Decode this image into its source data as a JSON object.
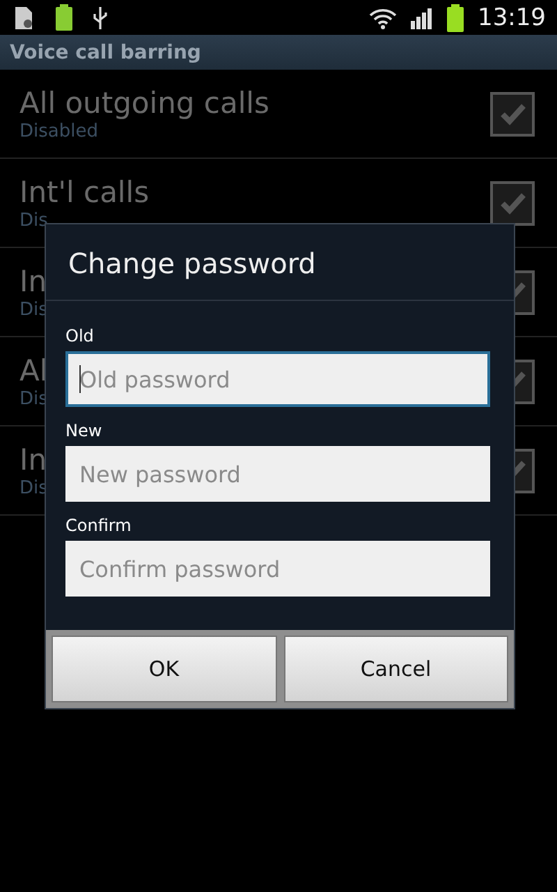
{
  "status_bar": {
    "time": "13:19"
  },
  "title_bar": {
    "title": "Voice call barring"
  },
  "settings": [
    {
      "title": "All outgoing calls",
      "summary": "Disabled",
      "checked": true,
      "disabled": true
    },
    {
      "title": "Int'l calls",
      "summary": "Dis",
      "checked": true,
      "disabled": true
    },
    {
      "title": "In",
      "summary": "Dis",
      "checked": true,
      "disabled": true
    },
    {
      "title": "Al",
      "summary": "Dis",
      "checked": true,
      "disabled": true
    },
    {
      "title": "In",
      "summary": "Dis",
      "checked": true,
      "disabled": true
    }
  ],
  "dialog": {
    "title": "Change password",
    "fields": [
      {
        "label": "Old",
        "placeholder": "Old password",
        "focused": true
      },
      {
        "label": "New",
        "placeholder": "New password",
        "focused": false
      },
      {
        "label": "Confirm",
        "placeholder": "Confirm password",
        "focused": false
      }
    ],
    "buttons": [
      "OK",
      "Cancel"
    ]
  }
}
